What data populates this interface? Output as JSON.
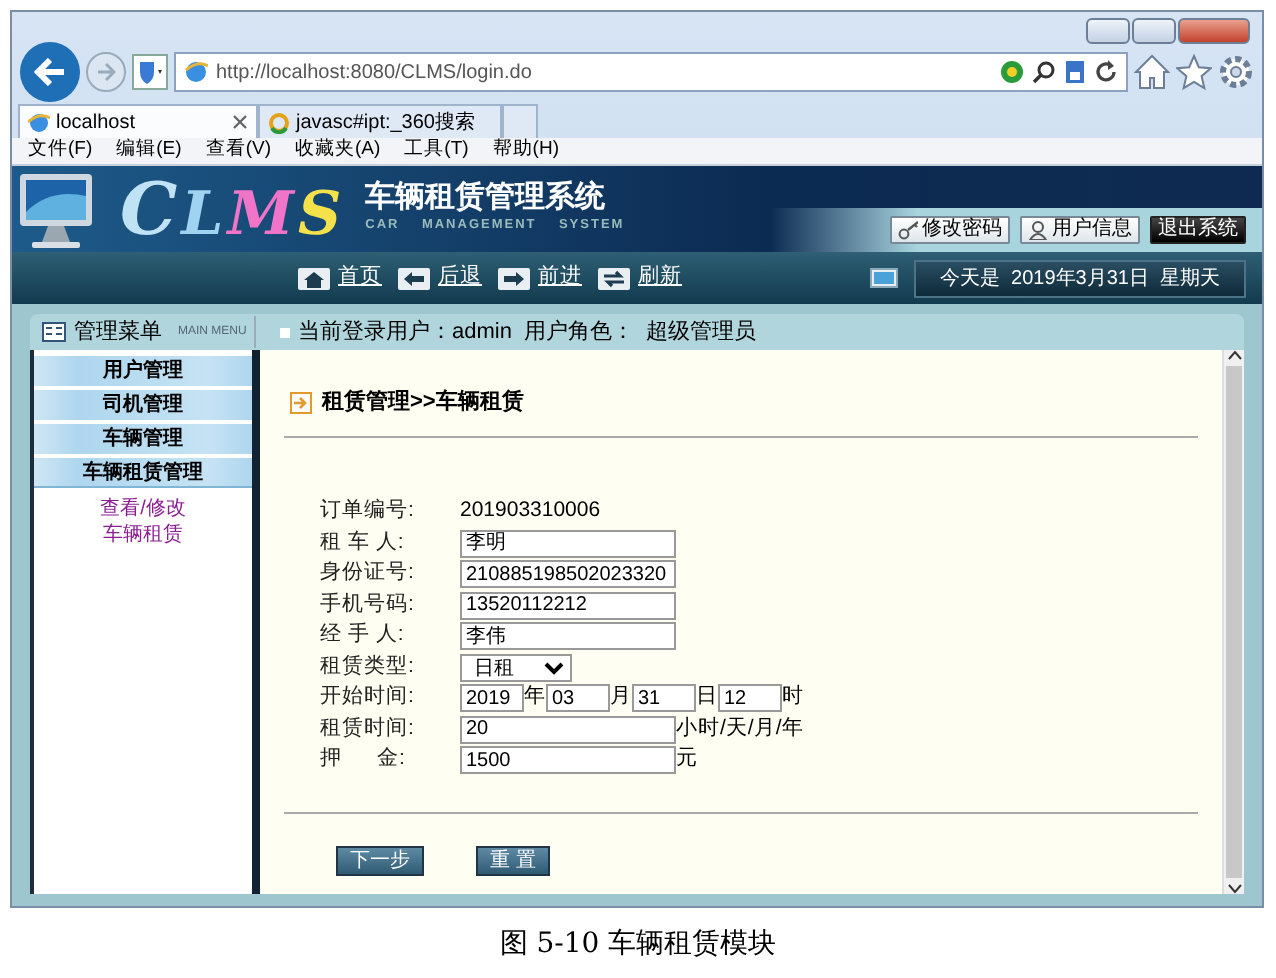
{
  "browser": {
    "address": "http://localhost:8080/CLMS/login.do",
    "tabs": [
      {
        "label": "localhost",
        "selected": true
      },
      {
        "label": "javasc#ipt:_360搜索",
        "selected": false
      }
    ],
    "menu": [
      "文件(F)",
      "编辑(E)",
      "查看(V)",
      "收藏夹(A)",
      "工具(T)",
      "帮助(H)"
    ]
  },
  "app": {
    "logo": "CLMS",
    "title": "车辆租赁管理系统",
    "subtitle": "CAR    MANAGEMENT    SYSTEM",
    "header_buttons": [
      {
        "label": "修改密码",
        "kind": "key"
      },
      {
        "label": "用户信息",
        "kind": "user"
      },
      {
        "label": "退出系统",
        "kind": "exit"
      }
    ],
    "nav": [
      {
        "label": "首页",
        "kind": "home"
      },
      {
        "label": "后退",
        "kind": "back"
      },
      {
        "label": "前进",
        "kind": "forward"
      },
      {
        "label": "刷新",
        "kind": "refresh"
      }
    ],
    "date": "今天是  2019年3月31日  星期天"
  },
  "sidebar": {
    "title": "管理菜单",
    "subtitle": "MAIN MENU",
    "groups": [
      {
        "label": "用户管理",
        "expanded": false
      },
      {
        "label": "司机管理",
        "expanded": false
      },
      {
        "label": "车辆管理",
        "expanded": false
      },
      {
        "label": "车辆租赁管理",
        "expanded": true,
        "children": [
          "查看/修改",
          "车辆租赁"
        ]
      }
    ]
  },
  "user_bar": "当前登录用户：admin  用户角色：  超级管理员",
  "breadcrumb": "租赁管理>>车辆租赁",
  "form": [
    {
      "label": "订单编号:",
      "kind": "text",
      "value": "201903310006"
    },
    {
      "label": "租 车 人:",
      "kind": "input",
      "value": "李明"
    },
    {
      "label": "身份证号:",
      "kind": "input",
      "value": "210885198502023320"
    },
    {
      "label": "手机号码:",
      "kind": "input",
      "value": "13520112212"
    },
    {
      "label": "经 手 人:",
      "kind": "input",
      "value": "李伟"
    },
    {
      "label": "租赁类型:",
      "kind": "select",
      "value": "日租"
    },
    {
      "label": "开始时间:",
      "kind": "datetime",
      "parts": [
        {
          "value": "2019",
          "unit": "年"
        },
        {
          "value": "03",
          "unit": "月"
        },
        {
          "value": "31",
          "unit": "日"
        },
        {
          "value": "12",
          "unit": "时"
        }
      ]
    },
    {
      "label": "租赁时间:",
      "kind": "input",
      "value": "20",
      "suffix": "小时/天/月/年"
    },
    {
      "label": "押      金:",
      "kind": "input",
      "value": "1500",
      "suffix": "元"
    }
  ],
  "buttons": [
    "下一步",
    "重 置"
  ],
  "caption": "图 5-10 车辆租赁模块"
}
